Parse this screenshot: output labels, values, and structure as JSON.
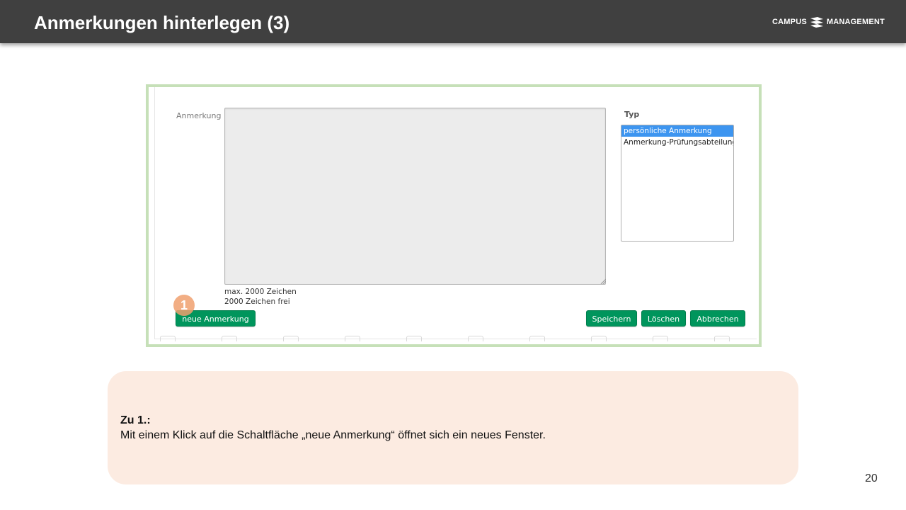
{
  "header": {
    "title": "Anmerkungen hinterlegen (3)",
    "logo_left": "CAMPUS",
    "logo_right": "MANAGEMENT"
  },
  "form": {
    "note_label": "Anmerkung",
    "type_label": "Typ",
    "max_chars": "max. 2000 Zeichen",
    "chars_free": "2000 Zeichen frei",
    "type_options": [
      {
        "label": "persönliche Anmerkung",
        "selected": true
      },
      {
        "label": "Anmerkung-Prüfungsabteilung",
        "selected": false
      }
    ],
    "buttons": {
      "new_note": "neue Anmerkung",
      "save": "Speichern",
      "delete": "Löschen",
      "cancel": "Abbrechen"
    },
    "badge": "1"
  },
  "info": {
    "title": "Zu 1.:",
    "text": "Mit einem Klick auf die Schaltfläche „neue Anmerkung“ öffnet sich ein neues Fenster."
  },
  "page_number": "20",
  "colors": {
    "header_bg": "#404040",
    "frame_border": "#c6e0b8",
    "button_green": "#00955c",
    "selection_blue": "#3d95f0",
    "info_bg": "#fcebe1",
    "badge": "#f0a06e"
  }
}
